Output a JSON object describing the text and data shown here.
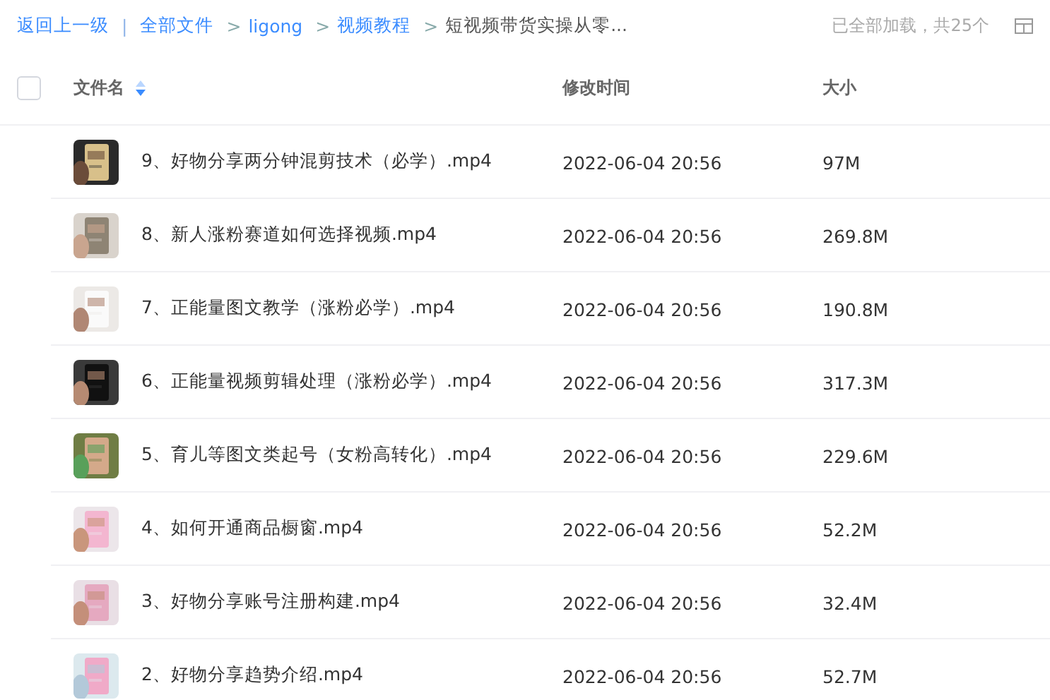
{
  "breadcrumb": {
    "back": "返回上一级",
    "separator": "|",
    "items": [
      {
        "label": "全部文件",
        "link": true
      },
      {
        "label": "ligong",
        "link": true
      },
      {
        "label": "视频教程",
        "link": true
      },
      {
        "label": "短视频带货实操从零...",
        "link": false
      }
    ],
    "arrow": ">"
  },
  "status": "已全部加载，共25个",
  "table": {
    "select_all": {
      "checked": false
    },
    "columns": [
      {
        "label": "文件名",
        "sortable": true
      },
      {
        "label": "修改时间",
        "sortable": false
      },
      {
        "label": "大小",
        "sortable": false
      }
    ],
    "rows": [
      {
        "name": "9、好物分享两分钟混剪技术（必学）.mp4",
        "modified": "2022-06-04 20:56",
        "size": "97M"
      },
      {
        "name": "8、新人涨粉赛道如何选择视频.mp4",
        "modified": "2022-06-04 20:56",
        "size": "269.8M"
      },
      {
        "name": "7、正能量图文教学（涨粉必学）.mp4",
        "modified": "2022-06-04 20:56",
        "size": "190.8M"
      },
      {
        "name": "6、正能量视频剪辑处理（涨粉必学）.mp4",
        "modified": "2022-06-04 20:56",
        "size": "317.3M"
      },
      {
        "name": "5、育儿等图文类起号（女粉高转化）.mp4",
        "modified": "2022-06-04 20:56",
        "size": "229.6M"
      },
      {
        "name": "4、如何开通商品橱窗.mp4",
        "modified": "2022-06-04 20:56",
        "size": "52.2M"
      },
      {
        "name": "3、好物分享账号注册构建.mp4",
        "modified": "2022-06-04 20:56",
        "size": "32.4M"
      },
      {
        "name": "2、好物分享趋势介绍.mp4",
        "modified": "2022-06-04 20:56",
        "size": "52.7M"
      }
    ]
  }
}
